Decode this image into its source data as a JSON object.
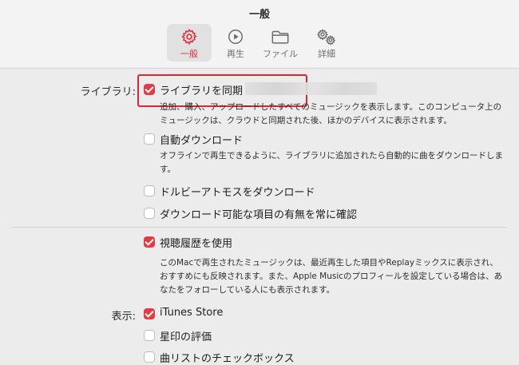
{
  "window": {
    "title": "一般"
  },
  "toolbar": {
    "items": [
      {
        "label": "一般",
        "icon": "gear-icon",
        "active": true
      },
      {
        "label": "再生",
        "icon": "play-circle-icon",
        "active": false
      },
      {
        "label": "ファイル",
        "icon": "folder-icon",
        "active": false
      },
      {
        "label": "詳細",
        "icon": "gears-icon",
        "active": false
      }
    ]
  },
  "library": {
    "section_label": "ライブラリ:",
    "sync": {
      "label": "ライブラリを同期",
      "checked": true,
      "description": "追加、購入、アップロードしたすべてのミュージックを表示します。このコンピュータ上のミュージックは、クラウドと同期された後、ほかのデバイスに表示されます。"
    },
    "auto_download": {
      "label": "自動ダウンロード",
      "checked": false,
      "description": "オフラインで再生できるように、ライブラリに追加されたら自動的に曲をダウンロードします。"
    },
    "dolby": {
      "label": "ドルビーアトモスをダウンロード",
      "checked": false
    },
    "always_check": {
      "label": "ダウンロード可能な項目の有無を常に確認",
      "checked": false
    }
  },
  "history": {
    "use_history": {
      "label": "視聴履歴を使用",
      "checked": true,
      "description": "このMacで再生されたミュージックは、最近再生した項目やReplayミックスに表示され、おすすめにも反映されます。また、Apple Musicのプロフィールを設定している場合は、あなたをフォローしている人にも表示されます。"
    }
  },
  "display": {
    "section_label": "表示:",
    "itunes_store": {
      "label": "iTunes Store",
      "checked": true
    },
    "star_rating": {
      "label": "星印の評価",
      "checked": false
    },
    "song_checkbox": {
      "label": "曲リストのチェックボックス",
      "checked": false
    }
  },
  "colors": {
    "accent": "#e33a45",
    "highlight_box": "#e0262f"
  }
}
